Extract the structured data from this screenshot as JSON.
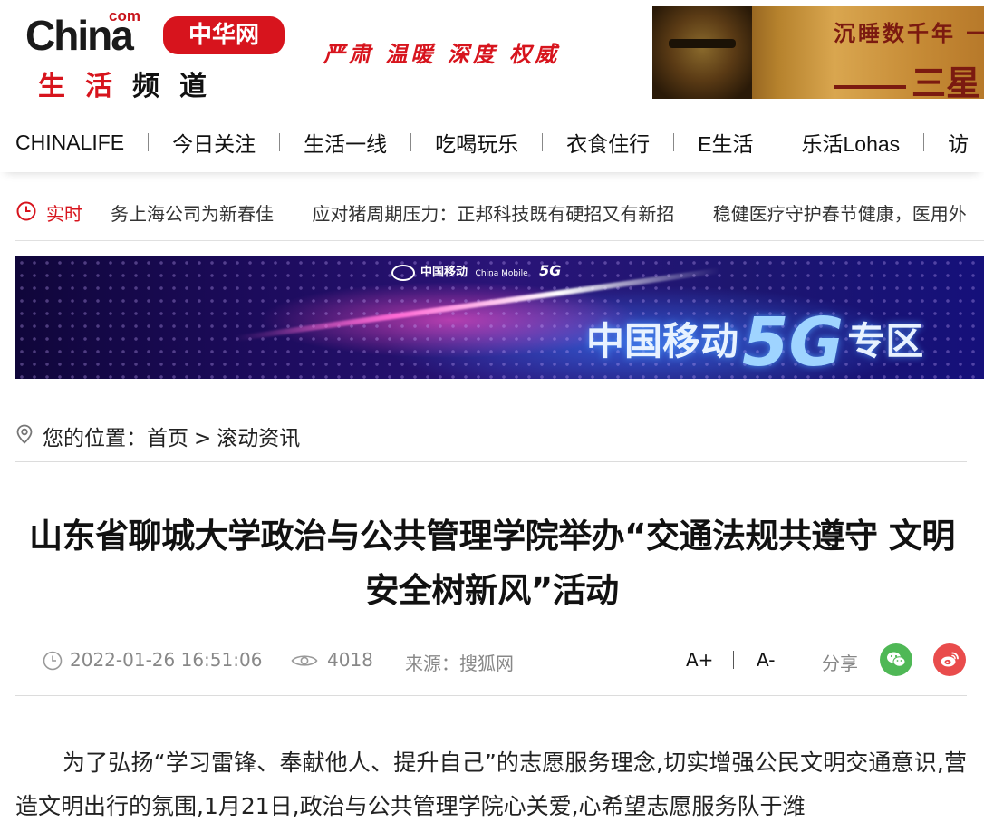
{
  "header": {
    "logo_com": "com",
    "logo_china": "China",
    "logo_badge": "中华网",
    "logo_sub_red": "生活",
    "logo_sub_dark": "频道",
    "slogan": "严肃 温暖 深度 权威",
    "ad_line1": "沉睡数千年 一",
    "ad_line2": "三星"
  },
  "nav": {
    "items": [
      "CHINALIFE",
      "今日关注",
      "生活一线",
      "吃喝玩乐",
      "衣食住行",
      "E生活",
      "乐活Lohas",
      "访"
    ]
  },
  "ticker": {
    "label": "实时",
    "items": [
      "务上海公司为新春佳",
      "应对猪周期压力：正邦科技既有硬招又有新招",
      "稳健医疗守护春节健康，医用外"
    ]
  },
  "banner": {
    "brand_cn": "中国移动",
    "brand_en": "China Mobile",
    "brand_5g": "5G",
    "headline_prefix": "中国移动",
    "headline_5g": "5G",
    "headline_suffix": "专区"
  },
  "breadcrumb": {
    "prefix": "您的位置：",
    "home": "首页",
    "separator": ">",
    "current": "滚动资讯"
  },
  "article": {
    "title": "山东省聊城大学政治与公共管理学院举办“交通法规共遵守 文明安全树新风”活动",
    "date": "2022-01-26 16:51:06",
    "views": "4018",
    "source": "来源：搜狐网",
    "font_increase": "A+",
    "font_decrease": "A-",
    "share_label": "分享",
    "body": "为了弘扬“学习雷锋、奉献他人、提升自己”的志愿服务理念,切实增强公民文明交通意识,营造文明出行的氛围,1月21日,政治与公共管理学院心关爱,心希望志愿服务队于潍"
  },
  "colors": {
    "brand_red": "#d7141d",
    "wechat_green": "#4fb856",
    "weibo_red": "#e94c4c",
    "meta_gray": "#888888"
  }
}
